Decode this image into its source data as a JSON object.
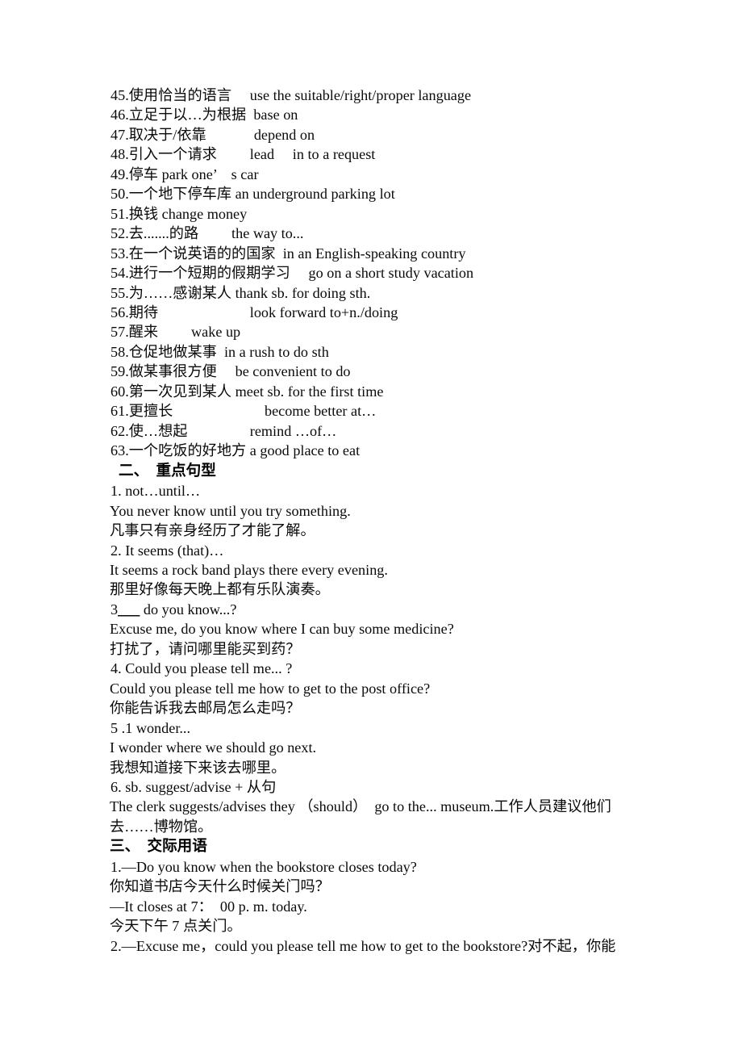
{
  "document": {
    "page_background": "#ffffff",
    "text_color": "#0a0a0a",
    "vocabulary_lines": [
      "45.使用恰当的语言　 use the suitable/right/proper language",
      "46.立足于以…为根据  base on",
      "47.取决于/依靠　　　 depend on",
      "48.引入一个请求　　 lead　 in to a request",
      "49.停车 park one’　s car",
      "50.一个地下停车库 an underground parking lot",
      "51.换钱 change money",
      "52.去.......的路　　 the way to...",
      "53.在一个说英语的的国家  in an English-speaking country",
      "54.进行一个短期的假期学习　 go on a short study vacation",
      "55.为……感谢某人 thank sb. for doing sth.",
      "56.期待　　　　　　 look forward to+n./doing",
      "57.醒来　　 wake up",
      "58.仓促地做某事  in a rush to do sth",
      "59.做某事很方便　 be convenient to do",
      "60.第一次见到某人 meet sb. for the first time",
      "61.更擅长　　　　　　 become better at…",
      "62.使…想起　　　　 remind …of…",
      "63.一个吃饭的好地方 a good place to eat"
    ],
    "section_two": {
      "heading": "二、　重点句型",
      "entries": [
        {
          "pattern": "1. not…until…",
          "example": "You never know until you try something.",
          "translation": "凡事只有亲身经历了才能了解。"
        },
        {
          "pattern": "2. It seems (that)…",
          "example": "It seems a rock band plays there every evening.",
          "translation": "那里好像每天晚上都有乐队演奏。"
        },
        {
          "pattern_pre": "3",
          "pattern_blank": "___",
          "pattern_post": " do you know...?",
          "example": "Excuse me, do you know where I can buy some medicine?",
          "translation": "打扰了，请问哪里能买到药？"
        },
        {
          "pattern": "4. Could you please tell me... ?",
          "example": "Could you please tell me how to get to the post office?",
          "translation": "你能告诉我去邮局怎么走吗？"
        },
        {
          "pattern": "5 .1 wonder...",
          "example": "I wonder where we should go next.",
          "translation": "我想知道接下来该去哪里。"
        },
        {
          "pattern": "6. sb. suggest/advise + 从句",
          "example": "The clerk suggests/advises they （should）　go to the... museum.工作人员建议他们去……博物馆。",
          "translation": ""
        }
      ]
    },
    "section_three": {
      "heading": "三、　交际用语",
      "entries": [
        {
          "question": "1.—Do you know when the bookstore closes today?",
          "question_translation": "你知道书店今天什么时候关门吗？",
          "answer": "—It closes at 7：　00 p. m. today.",
          "answer_translation": "今天下午 7 点关门。"
        },
        {
          "question": "2.—Excuse me，could you please tell me how to get to the bookstore?对不起，你能",
          "question_translation": "",
          "answer": "",
          "answer_translation": ""
        }
      ]
    }
  }
}
